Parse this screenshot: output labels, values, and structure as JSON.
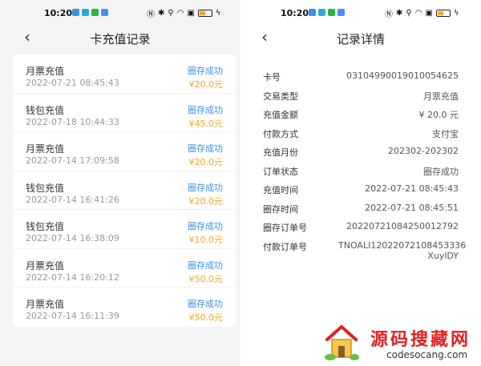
{
  "status_bar": {
    "time": "10:20"
  },
  "left_screen": {
    "title": "卡充值记录",
    "records": [
      {
        "type": "月票充值",
        "time": "2022-07-21 08:45:43",
        "status": "圈存成功",
        "amount": "¥20.0元"
      },
      {
        "type": "钱包充值",
        "time": "2022-07-18 10:44:33",
        "status": "圈存成功",
        "amount": "¥45.0元"
      },
      {
        "type": "月票充值",
        "time": "2022-07-14 17:09:58",
        "status": "圈存成功",
        "amount": "¥20.0元"
      },
      {
        "type": "钱包充值",
        "time": "2022-07-14 16:41:26",
        "status": "圈存成功",
        "amount": "¥20.0元"
      },
      {
        "type": "钱包充值",
        "time": "2022-07-14 16:38:09",
        "status": "圈存成功",
        "amount": "¥10.0元"
      },
      {
        "type": "月票充值",
        "time": "2022-07-14 16:20:12",
        "status": "圈存成功",
        "amount": "¥50.0元"
      },
      {
        "type": "月票充值",
        "time": "2022-07-14 16:11:39",
        "status": "圈存成功",
        "amount": "¥50.0元"
      }
    ]
  },
  "right_screen": {
    "title": "记录详情",
    "details": [
      {
        "label": "卡号",
        "value": "03104990019010054625"
      },
      {
        "label": "交易类型",
        "value": "月票充值"
      },
      {
        "label": "充值金额",
        "value": "¥ 20.0 元"
      },
      {
        "label": "付款方式",
        "value": "支付宝"
      },
      {
        "label": "充值月份",
        "value": "202302-202302"
      },
      {
        "label": "订单状态",
        "value": "圈存成功"
      },
      {
        "label": "充值时间",
        "value": "2022-07-21 08:45:43"
      },
      {
        "label": "圈存时间",
        "value": "2022-07-21 08:45:51"
      },
      {
        "label": "圈存订单号",
        "value": "20220721084250012792"
      },
      {
        "label": "付款订单号",
        "value": "TNOALI12022072108453336\nXuylDY"
      }
    ]
  },
  "watermark": {
    "title": "源码搜藏网",
    "url": "codesocang.com"
  },
  "colors": {
    "status_blue": "#3a8fe8",
    "amount_orange": "#f5a623",
    "watermark_red": "#e02020"
  }
}
